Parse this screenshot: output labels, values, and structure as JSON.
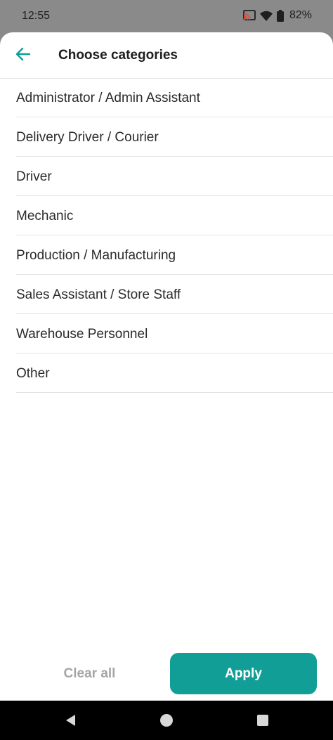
{
  "status_bar": {
    "time": "12:55",
    "battery": "82%",
    "icons": [
      "cast-icon",
      "wifi-icon",
      "battery-icon"
    ]
  },
  "header": {
    "title": "Choose categories",
    "back_icon": "arrow-left-icon"
  },
  "categories": [
    {
      "label": "Administrator / Admin Assistant"
    },
    {
      "label": "Delivery Driver / Courier"
    },
    {
      "label": "Driver"
    },
    {
      "label": "Mechanic"
    },
    {
      "label": "Production / Manufacturing"
    },
    {
      "label": "Sales Assistant / Store Staff"
    },
    {
      "label": "Warehouse Personnel"
    },
    {
      "label": "Other"
    }
  ],
  "footer": {
    "clear_label": "Clear all",
    "apply_label": "Apply"
  },
  "colors": {
    "accent": "#119e97",
    "status_bar": "#8a8a8a",
    "disabled_text": "#a6a6a6"
  },
  "nav_bar": {
    "icons": [
      "back-triangle-icon",
      "home-circle-icon",
      "recents-square-icon"
    ]
  }
}
